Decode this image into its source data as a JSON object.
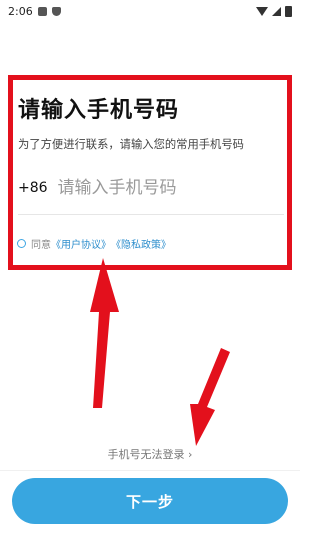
{
  "status_bar": {
    "time": "2:06"
  },
  "title": "请输入手机号码",
  "subtitle": "为了方便进行联系，请输入您的常用手机号码",
  "phone": {
    "country_code": "+86",
    "placeholder": "请输入手机号码",
    "value": ""
  },
  "agreement": {
    "prefix": "同意",
    "user_agreement": "《用户协议》",
    "privacy_policy": "《隐私政策》",
    "checked": false
  },
  "cant_login": "手机号无法登录 ›",
  "next_button": "下一步",
  "colors": {
    "accent": "#38a6e0",
    "highlight": "#e3101c",
    "link": "#2f8fcd"
  }
}
